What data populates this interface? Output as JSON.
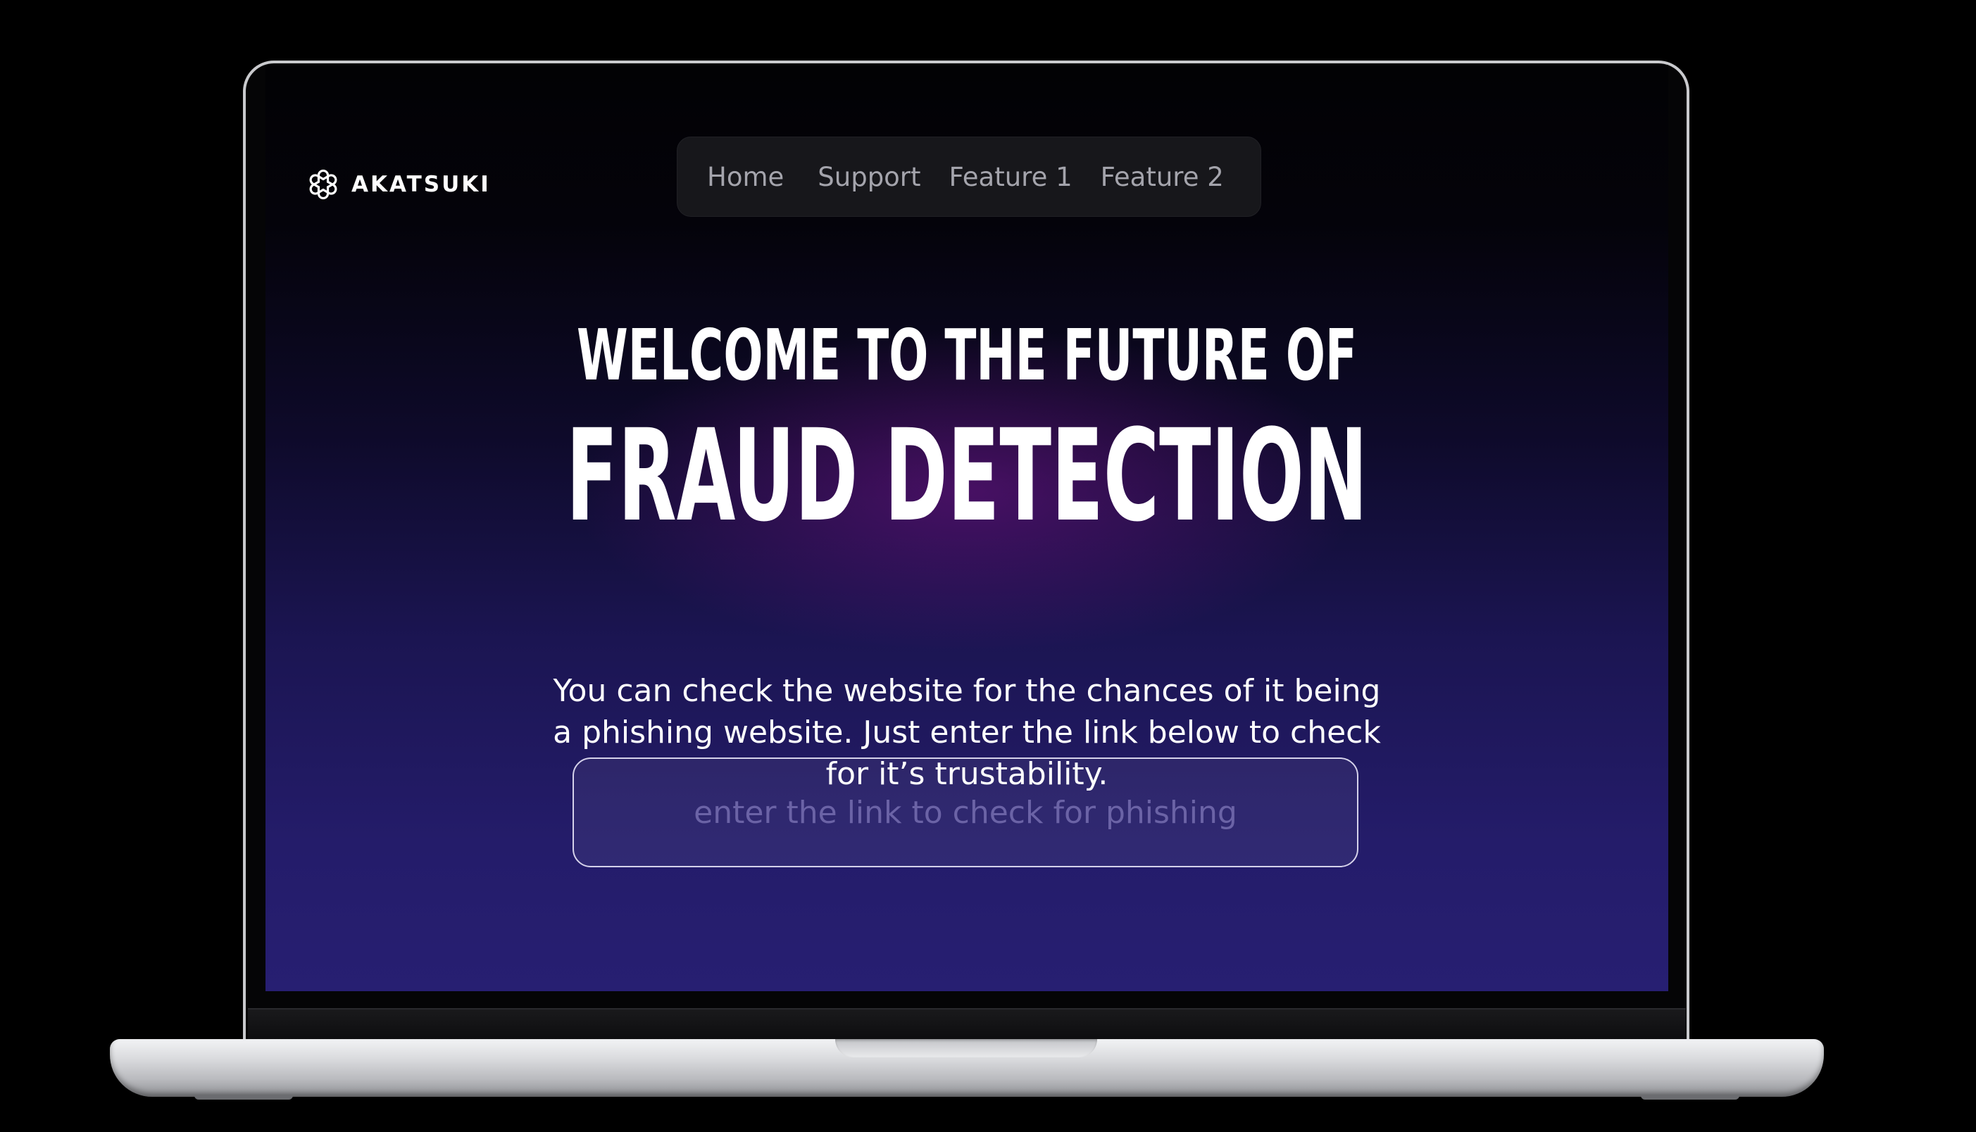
{
  "brand": {
    "name": "AKATSUKI",
    "logo_icon": "knot-logo-icon"
  },
  "nav": {
    "items": [
      {
        "label": "Home"
      },
      {
        "label": "Support"
      },
      {
        "label": "Feature 1"
      },
      {
        "label": "Feature 2"
      }
    ]
  },
  "hero": {
    "line1": "WELCOME TO THE FUTURE OF",
    "line2": "FRAUD DETECTION",
    "description": "You can check the website for the chances of it being a phishing website. Just enter the link below to check for it’s trustability."
  },
  "link_check": {
    "value": "",
    "placeholder": "enter the link to check for phishing"
  },
  "colors": {
    "background_top": "#020204",
    "background_bottom": "#271f72",
    "glow": "#74128a",
    "nav_bg": "#17171b",
    "nav_text": "#a4a4ac",
    "placeholder": "#6b63a6"
  }
}
